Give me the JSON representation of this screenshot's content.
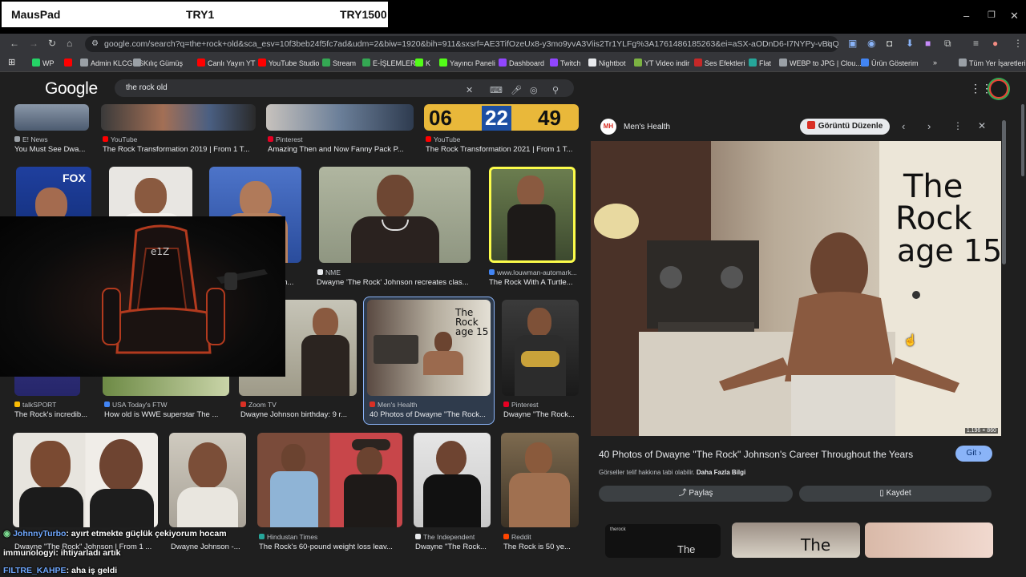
{
  "overlay_banner": {
    "label_left": "MausPad",
    "label_mid": "TRY1",
    "label_right": "TRY1500"
  },
  "window_controls": {
    "minimize": "–",
    "restore": "❐",
    "close": "✕"
  },
  "address_bar": {
    "url": "google.com/search?q=the+rock+old&sca_esv=10f3beb24f5fc7ad&udm=2&biw=1920&bih=911&sxsrf=AE3TifOzeUx8-y3mo9yvA3Viis2Tr1YLFg%3A1761486185263&ei=aSX-aODnD6-I7NYPy-vBqQE&ved=0ahUKE..."
  },
  "bookmarks": [
    {
      "label": "WP",
      "color": "#25d366"
    },
    {
      "label": "",
      "color": "#ff0000"
    },
    {
      "label": "Admin KLCGMS",
      "color": "#9aa0a6"
    },
    {
      "label": "Kılıç Gümüş",
      "color": "#9aa0a6"
    },
    {
      "label": "Canlı Yayın YT",
      "color": "#ff0000"
    },
    {
      "label": "YouTube Studio",
      "color": "#ff0000"
    },
    {
      "label": "Stream",
      "color": "#34a853"
    },
    {
      "label": "E-İŞLEMLER",
      "color": "#34a853"
    },
    {
      "label": "K",
      "color": "#53fc18"
    },
    {
      "label": "Yayıncı Paneli",
      "color": "#53fc18"
    },
    {
      "label": "Dashboard",
      "color": "#9146ff"
    },
    {
      "label": "Twitch",
      "color": "#9146ff"
    },
    {
      "label": "Nightbot",
      "color": "#e8eaed"
    },
    {
      "label": "YT Video indir",
      "color": "#7cb342"
    },
    {
      "label": "Ses Efektleri",
      "color": "#c62828"
    },
    {
      "label": "Flat",
      "color": "#26a69a"
    },
    {
      "label": "WEBP to JPG | Clou...",
      "color": "#9aa0a6"
    },
    {
      "label": "Ürün Gösterim",
      "color": "#4285f4"
    },
    {
      "label": "»",
      "color": ""
    },
    {
      "label": "Tüm Yer İşaretleri",
      "color": "#9aa0a6"
    }
  ],
  "google": {
    "logo": "Google",
    "query": "the rock old"
  },
  "results_row1": [
    {
      "source": "E! News",
      "title": "You Must See Dwa...",
      "src_color": "#9aa0a6"
    },
    {
      "source": "YouTube",
      "title": "The Rock Transformation 2019 | From 1 T...",
      "src_color": "#ff0000"
    },
    {
      "source": "Pinterest",
      "title": "Amazing Then and Now Fanny Pack P...",
      "src_color": "#e60023"
    },
    {
      "source": "YouTube",
      "title": "The Rock Transformation 2021 | From 1 T...",
      "src_color": "#ff0000"
    }
  ],
  "thumb_digits": [
    "06",
    "22",
    "49"
  ],
  "thumb_logo_fox": "FOX",
  "results_row2": [
    {
      "source": "",
      "title": "...oh...",
      "src_color": ""
    },
    {
      "source": "NME",
      "title": "Dwayne 'The Rock' Johnson recreates clas...",
      "src_color": "#e8eaed"
    },
    {
      "source": "www.louwman-automark...",
      "title": "The Rock With A Turtle...",
      "src_color": "#4285f4"
    }
  ],
  "results_row3": [
    {
      "source": "talkSPORT",
      "title": "The Rock's incredib...",
      "src_color": "#fbbc04"
    },
    {
      "source": "USA Today's FTW",
      "title": "How old is WWE superstar The ...",
      "src_color": "#4285f4"
    },
    {
      "source": "Zoom TV",
      "title": "Dwayne Johnson birthday: 9 r...",
      "src_color": "#d93025"
    },
    {
      "source": "Men's Health",
      "title": "40 Photos of Dwayne \"The Rock...",
      "src_color": "#d93025"
    },
    {
      "source": "Pinterest",
      "title": "Dwayne \"The Rock...",
      "src_color": "#e60023"
    }
  ],
  "results_row4": [
    {
      "source": "",
      "title": "Dwayne \"The Rock\" Johnson | From 1 ...",
      "src_color": ""
    },
    {
      "source": "",
      "title": "Dwayne Johnson -...",
      "src_color": ""
    },
    {
      "source": "Hindustan Times",
      "title": "The Rock's 60-pound weight loss leav...",
      "src_color": "#26a69a"
    },
    {
      "source": "The Independent",
      "title": "Dwayne \"The Rock...",
      "src_color": "#e8eaed"
    },
    {
      "source": "Reddit",
      "title": "The Rock is 50 ye...",
      "src_color": "#ff4500"
    }
  ],
  "thumb_caption": "The Rock age 15",
  "panel": {
    "source": "Men's Health",
    "source_badge": "MH",
    "edit_button": "Görüntü Düzenle",
    "image_caption": "The Rock age 15",
    "dimensions": "1.196 × 860",
    "title": "40 Photos of Dwayne \"The Rock\" Johnson's Career Throughout the Years",
    "go_button": "Git",
    "copyright": "Görseller telif hakkına tabi olabilir.",
    "more_info": "Daha Fazla Bilgi",
    "share": "Paylaş",
    "save": "Kaydet",
    "related_caption_1": "The",
    "related_caption_2": "The",
    "related_user": "therock"
  },
  "chair_logo": "e1Z",
  "chat": [
    {
      "user": "JohnnyTurbo",
      "message": ": ayırt etmekte güçlük çekiyorum hocam",
      "color": "#6fa8ff"
    },
    {
      "user": "immunologyi",
      "message": ": ihtiyarladı artık",
      "color": "#ffffff"
    },
    {
      "user": "FILTRE_KAHPE",
      "message": ": aha iş geldi",
      "color": "#6fa8ff"
    }
  ]
}
